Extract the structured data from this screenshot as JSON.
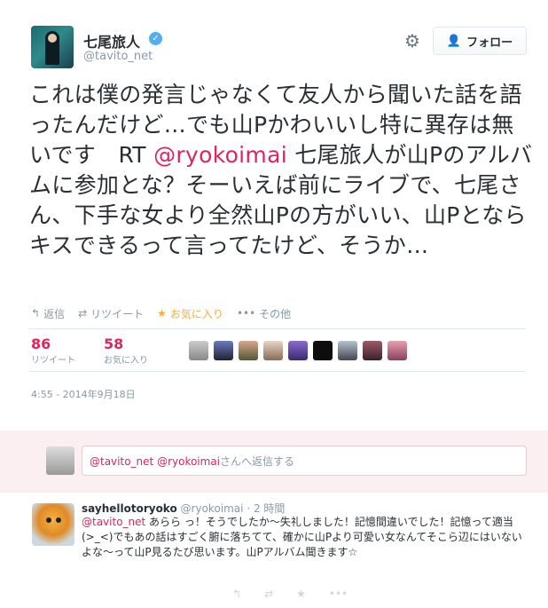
{
  "tweet": {
    "display_name": "七尾旅人",
    "handle": "@tavito_net",
    "follow_label": "フォロー",
    "text_before": "これは僕の発言じゃなくて友人から聞いた話を語ったんだけど…でも山Pかわいいし特に異存は無いです　RT ",
    "text_mention": "@ryokoimai",
    "text_after": " 七尾旅人が山Pのアルバムに参加とな？そーいえば前にライブで、七尾さん、下手な女より全然山Pの方がいい、山Pとならキスできるって言ってたけど、そうか…",
    "actions": {
      "reply": "返信",
      "retweet": "リツイート",
      "favorite": "お気に入り",
      "more": "その他"
    },
    "stats": {
      "retweets": "86",
      "retweets_label": "リツイート",
      "favorites": "58",
      "favorites_label": "お気に入り"
    },
    "timestamp": "4:55 - 2014年9月18日"
  },
  "reply_box": {
    "mention1": "@tavito_net",
    "mention2": "@ryokoimai",
    "suffix": "さんへ返信する"
  },
  "reply_tweet": {
    "name": "sayhellotoryoko",
    "handle": "@ryokoimai",
    "sep": "·",
    "time": "2 時間",
    "mention": "@tavito_net",
    "text": " あらら っ！そうでしたか〜失礼しました！記憶間違いでした！記憶って適当(>_<)でもあの話はすごく腑に落ちてて、確かに山Pより可愛い女なんてそこら辺にはいないよな〜って山P見るたび思います。山Pアルバム聞きます☆"
  },
  "colors": {
    "accent": "#e0245e",
    "blue": "#55acee",
    "muted": "#8899a6",
    "favorite": "#ffac33",
    "reply_bg": "#fbeff2"
  },
  "icons": [
    "gear-icon",
    "verified-icon",
    "reply-icon",
    "retweet-icon",
    "star-icon",
    "more-icon",
    "person-add-icon"
  ]
}
